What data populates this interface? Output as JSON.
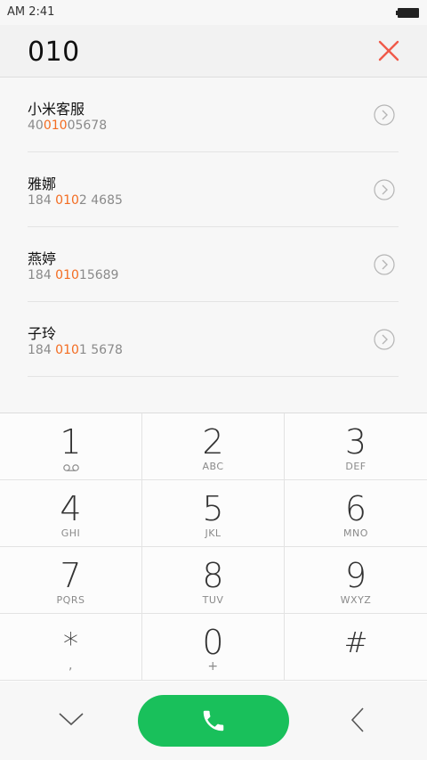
{
  "status_bar": {
    "time": "AM 2:41"
  },
  "input": {
    "dialed": "010"
  },
  "results": [
    {
      "name": "小米客服",
      "num_pre": "40",
      "num_hl": "010",
      "num_post": "05678"
    },
    {
      "name": "雅娜",
      "num_pre": "184 ",
      "num_hl": "010",
      "num_post": "2 4685"
    },
    {
      "name": "燕婷",
      "num_pre": "184 ",
      "num_hl": "010",
      "num_post": "15689"
    },
    {
      "name": "子玲",
      "num_pre": "184 ",
      "num_hl": "010",
      "num_post": "1 5678"
    }
  ],
  "keypad": [
    {
      "digit": "1",
      "letters": "",
      "sub_icon": "voicemail-icon"
    },
    {
      "digit": "2",
      "letters": "ABC"
    },
    {
      "digit": "3",
      "letters": "DEF"
    },
    {
      "digit": "4",
      "letters": "GHI"
    },
    {
      "digit": "5",
      "letters": "JKL"
    },
    {
      "digit": "6",
      "letters": "MNO"
    },
    {
      "digit": "7",
      "letters": "PQRS"
    },
    {
      "digit": "8",
      "letters": "TUV"
    },
    {
      "digit": "9",
      "letters": "WXYZ"
    },
    {
      "digit": "*",
      "letters": ","
    },
    {
      "digit": "0",
      "letters": "+"
    },
    {
      "digit": "#",
      "letters": ""
    }
  ],
  "colors": {
    "accent": "#f36c21",
    "call": "#19c05b",
    "clear": "#f05a4a"
  },
  "icons": {
    "clear": "close-icon",
    "detail": "chevron-right-circle-icon",
    "collapse": "chevron-down-icon",
    "call": "phone-icon",
    "backspace": "chevron-left-icon"
  }
}
